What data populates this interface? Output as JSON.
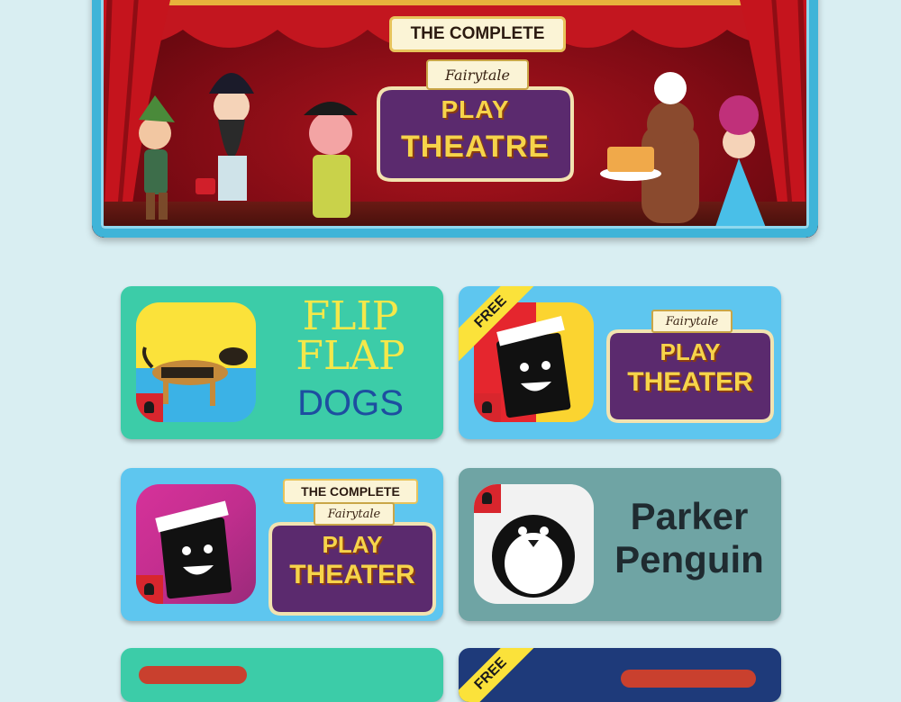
{
  "hero": {
    "banner_text": "THE COMPLETE",
    "marquee_script": "Fairytale",
    "marquee_line1": "PLAY",
    "marquee_line2": "THEATRE"
  },
  "tiles": [
    {
      "id": "flip-flap-dogs",
      "words": [
        "FLIP",
        "FLAP",
        "DOGS"
      ],
      "icon": "dachshund-dog-icon"
    },
    {
      "id": "fairytale-play-theater-free",
      "ribbon": "FREE",
      "script": "Fairytale",
      "line1": "PLAY",
      "line2": "THEATER",
      "icon": "clapperboard-smiley-icon"
    },
    {
      "id": "complete-fairytale-play-theater",
      "banner": "THE COMPLETE",
      "script": "Fairytale",
      "line1": "PLAY",
      "line2": "THEATER",
      "icon": "clapperboard-smiley-icon"
    },
    {
      "id": "parker-penguin",
      "line1": "Parker",
      "line2": "Penguin",
      "icon": "penguin-icon"
    },
    {
      "id": "partial-tile-left"
    },
    {
      "id": "partial-tile-right",
      "ribbon": "FREE"
    }
  ],
  "colors": {
    "page_bg": "#d9eef2",
    "teal_tile": "#3ccca8",
    "blue_tile": "#5ec6ef",
    "slate_tile": "#6fa4a4",
    "navy_tile": "#1e3a7a",
    "marquee_purple": "#5b2a6e",
    "marquee_gold": "#f6d44a"
  }
}
